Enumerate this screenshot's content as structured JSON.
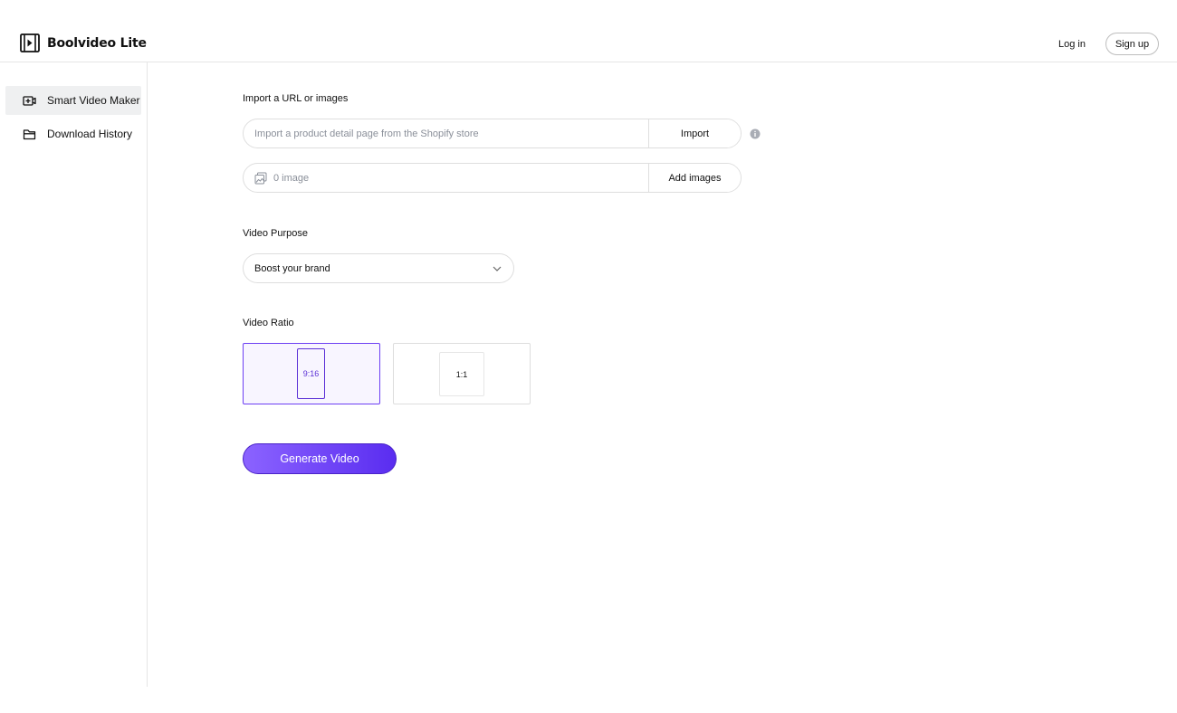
{
  "app": {
    "name": "Boolvideo Lite"
  },
  "header": {
    "login_label": "Log in",
    "signup_label": "Sign up"
  },
  "sidebar": {
    "items": [
      {
        "label": "Smart Video Maker",
        "icon": "video-plus-icon",
        "active": true
      },
      {
        "label": "Download History",
        "icon": "folder-icon",
        "active": false
      }
    ]
  },
  "import": {
    "label": "Import a URL or images",
    "url_placeholder": "Import a product detail page from the Shopify store",
    "import_button": "Import",
    "image_count": "0 image",
    "add_images_button": "Add images"
  },
  "purpose": {
    "label": "Video Purpose",
    "selected": "Boost your brand"
  },
  "ratio": {
    "label": "Video Ratio",
    "options": [
      {
        "label": "9:16",
        "selected": true
      },
      {
        "label": "1:1",
        "selected": false
      }
    ]
  },
  "generate_label": "Generate Video",
  "colors": {
    "accent": "#6d3ff4",
    "accent_light": "#8b63ff",
    "accent_dark": "#5a2df0"
  }
}
